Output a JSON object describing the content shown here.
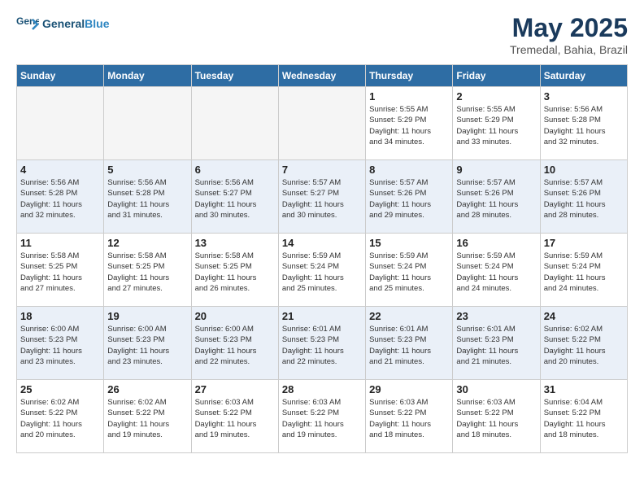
{
  "header": {
    "logo_line1": "General",
    "logo_line2": "Blue",
    "month": "May 2025",
    "location": "Tremedal, Bahia, Brazil"
  },
  "days_of_week": [
    "Sunday",
    "Monday",
    "Tuesday",
    "Wednesday",
    "Thursday",
    "Friday",
    "Saturday"
  ],
  "weeks": [
    [
      {
        "num": "",
        "info": "",
        "empty": true
      },
      {
        "num": "",
        "info": "",
        "empty": true
      },
      {
        "num": "",
        "info": "",
        "empty": true
      },
      {
        "num": "",
        "info": "",
        "empty": true
      },
      {
        "num": "1",
        "info": "Sunrise: 5:55 AM\nSunset: 5:29 PM\nDaylight: 11 hours\nand 34 minutes.",
        "empty": false
      },
      {
        "num": "2",
        "info": "Sunrise: 5:55 AM\nSunset: 5:29 PM\nDaylight: 11 hours\nand 33 minutes.",
        "empty": false
      },
      {
        "num": "3",
        "info": "Sunrise: 5:56 AM\nSunset: 5:28 PM\nDaylight: 11 hours\nand 32 minutes.",
        "empty": false
      }
    ],
    [
      {
        "num": "4",
        "info": "Sunrise: 5:56 AM\nSunset: 5:28 PM\nDaylight: 11 hours\nand 32 minutes.",
        "empty": false
      },
      {
        "num": "5",
        "info": "Sunrise: 5:56 AM\nSunset: 5:28 PM\nDaylight: 11 hours\nand 31 minutes.",
        "empty": false
      },
      {
        "num": "6",
        "info": "Sunrise: 5:56 AM\nSunset: 5:27 PM\nDaylight: 11 hours\nand 30 minutes.",
        "empty": false
      },
      {
        "num": "7",
        "info": "Sunrise: 5:57 AM\nSunset: 5:27 PM\nDaylight: 11 hours\nand 30 minutes.",
        "empty": false
      },
      {
        "num": "8",
        "info": "Sunrise: 5:57 AM\nSunset: 5:26 PM\nDaylight: 11 hours\nand 29 minutes.",
        "empty": false
      },
      {
        "num": "9",
        "info": "Sunrise: 5:57 AM\nSunset: 5:26 PM\nDaylight: 11 hours\nand 28 minutes.",
        "empty": false
      },
      {
        "num": "10",
        "info": "Sunrise: 5:57 AM\nSunset: 5:26 PM\nDaylight: 11 hours\nand 28 minutes.",
        "empty": false
      }
    ],
    [
      {
        "num": "11",
        "info": "Sunrise: 5:58 AM\nSunset: 5:25 PM\nDaylight: 11 hours\nand 27 minutes.",
        "empty": false
      },
      {
        "num": "12",
        "info": "Sunrise: 5:58 AM\nSunset: 5:25 PM\nDaylight: 11 hours\nand 27 minutes.",
        "empty": false
      },
      {
        "num": "13",
        "info": "Sunrise: 5:58 AM\nSunset: 5:25 PM\nDaylight: 11 hours\nand 26 minutes.",
        "empty": false
      },
      {
        "num": "14",
        "info": "Sunrise: 5:59 AM\nSunset: 5:24 PM\nDaylight: 11 hours\nand 25 minutes.",
        "empty": false
      },
      {
        "num": "15",
        "info": "Sunrise: 5:59 AM\nSunset: 5:24 PM\nDaylight: 11 hours\nand 25 minutes.",
        "empty": false
      },
      {
        "num": "16",
        "info": "Sunrise: 5:59 AM\nSunset: 5:24 PM\nDaylight: 11 hours\nand 24 minutes.",
        "empty": false
      },
      {
        "num": "17",
        "info": "Sunrise: 5:59 AM\nSunset: 5:24 PM\nDaylight: 11 hours\nand 24 minutes.",
        "empty": false
      }
    ],
    [
      {
        "num": "18",
        "info": "Sunrise: 6:00 AM\nSunset: 5:23 PM\nDaylight: 11 hours\nand 23 minutes.",
        "empty": false
      },
      {
        "num": "19",
        "info": "Sunrise: 6:00 AM\nSunset: 5:23 PM\nDaylight: 11 hours\nand 23 minutes.",
        "empty": false
      },
      {
        "num": "20",
        "info": "Sunrise: 6:00 AM\nSunset: 5:23 PM\nDaylight: 11 hours\nand 22 minutes.",
        "empty": false
      },
      {
        "num": "21",
        "info": "Sunrise: 6:01 AM\nSunset: 5:23 PM\nDaylight: 11 hours\nand 22 minutes.",
        "empty": false
      },
      {
        "num": "22",
        "info": "Sunrise: 6:01 AM\nSunset: 5:23 PM\nDaylight: 11 hours\nand 21 minutes.",
        "empty": false
      },
      {
        "num": "23",
        "info": "Sunrise: 6:01 AM\nSunset: 5:23 PM\nDaylight: 11 hours\nand 21 minutes.",
        "empty": false
      },
      {
        "num": "24",
        "info": "Sunrise: 6:02 AM\nSunset: 5:22 PM\nDaylight: 11 hours\nand 20 minutes.",
        "empty": false
      }
    ],
    [
      {
        "num": "25",
        "info": "Sunrise: 6:02 AM\nSunset: 5:22 PM\nDaylight: 11 hours\nand 20 minutes.",
        "empty": false
      },
      {
        "num": "26",
        "info": "Sunrise: 6:02 AM\nSunset: 5:22 PM\nDaylight: 11 hours\nand 19 minutes.",
        "empty": false
      },
      {
        "num": "27",
        "info": "Sunrise: 6:03 AM\nSunset: 5:22 PM\nDaylight: 11 hours\nand 19 minutes.",
        "empty": false
      },
      {
        "num": "28",
        "info": "Sunrise: 6:03 AM\nSunset: 5:22 PM\nDaylight: 11 hours\nand 19 minutes.",
        "empty": false
      },
      {
        "num": "29",
        "info": "Sunrise: 6:03 AM\nSunset: 5:22 PM\nDaylight: 11 hours\nand 18 minutes.",
        "empty": false
      },
      {
        "num": "30",
        "info": "Sunrise: 6:03 AM\nSunset: 5:22 PM\nDaylight: 11 hours\nand 18 minutes.",
        "empty": false
      },
      {
        "num": "31",
        "info": "Sunrise: 6:04 AM\nSunset: 5:22 PM\nDaylight: 11 hours\nand 18 minutes.",
        "empty": false
      }
    ]
  ]
}
